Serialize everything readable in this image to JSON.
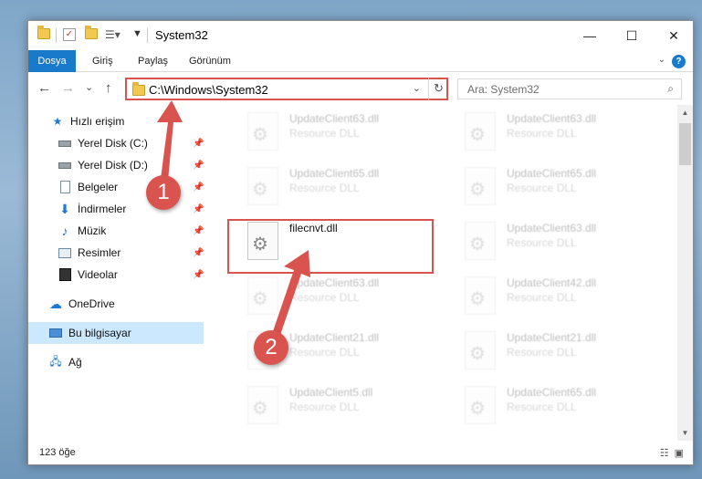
{
  "window": {
    "title": "System32",
    "controls": {
      "minimize": "—",
      "maximize": "☐",
      "close": "✕"
    }
  },
  "ribbon": {
    "tabs": [
      "Dosya",
      "Giriş",
      "Paylaş",
      "Görünüm"
    ],
    "help": "?"
  },
  "navigation": {
    "back": "←",
    "forward": "→",
    "recent": "⌄",
    "up": "↑",
    "address": "C:\\Windows\\System32",
    "refresh": "↻",
    "search_placeholder": "Ara: System32"
  },
  "sidebar": {
    "items": [
      {
        "label": "Hızlı erişim",
        "icon": "star-icon",
        "pinned": false
      },
      {
        "label": "Yerel Disk (C:)",
        "icon": "drive-icon",
        "pinned": true
      },
      {
        "label": "Yerel Disk (D:)",
        "icon": "drive-icon",
        "pinned": true
      },
      {
        "label": "Belgeler",
        "icon": "document-icon",
        "pinned": true
      },
      {
        "label": "İndirmeler",
        "icon": "download-icon",
        "pinned": true
      },
      {
        "label": "Müzik",
        "icon": "music-icon",
        "pinned": true
      },
      {
        "label": "Resimler",
        "icon": "pictures-icon",
        "pinned": true
      },
      {
        "label": "Videolar",
        "icon": "video-icon",
        "pinned": true
      },
      {
        "label": "OneDrive",
        "icon": "cloud-icon",
        "pinned": false
      },
      {
        "label": "Bu bilgisayar",
        "icon": "computer-icon",
        "pinned": false
      },
      {
        "label": "Ağ",
        "icon": "network-icon",
        "pinned": false
      }
    ]
  },
  "files": [
    {
      "name": "UpdateClient63.dll",
      "type": "Resource DLL"
    },
    {
      "name": "UpdateClient63.dll",
      "type": "Resource DLL"
    },
    {
      "name": "UpdateClient65.dll",
      "type": "Resource DLL"
    },
    {
      "name": "UpdateClient65.dll",
      "type": "Resource DLL"
    },
    {
      "name": "filecnvt.dll",
      "type": ""
    },
    {
      "name": "UpdateClient63.dll",
      "type": "Resource DLL"
    },
    {
      "name": "UpdateClient63.dll",
      "type": "Resource DLL"
    },
    {
      "name": "UpdateClient42.dll",
      "type": "Resource DLL"
    },
    {
      "name": "UpdateClient21.dll",
      "type": "Resource DLL"
    },
    {
      "name": "UpdateClient21.dll",
      "type": "Resource DLL"
    },
    {
      "name": "UpdateClient5.dll",
      "type": "Resource DLL"
    },
    {
      "name": "UpdateClient65.dll",
      "type": "Resource DLL"
    }
  ],
  "status": {
    "item_count": "123 öğe"
  },
  "annotations": {
    "step1": "1",
    "step2": "2"
  },
  "colors": {
    "accent": "#1979ca",
    "annotation": "#d9534f",
    "selected": "#cce8ff"
  }
}
